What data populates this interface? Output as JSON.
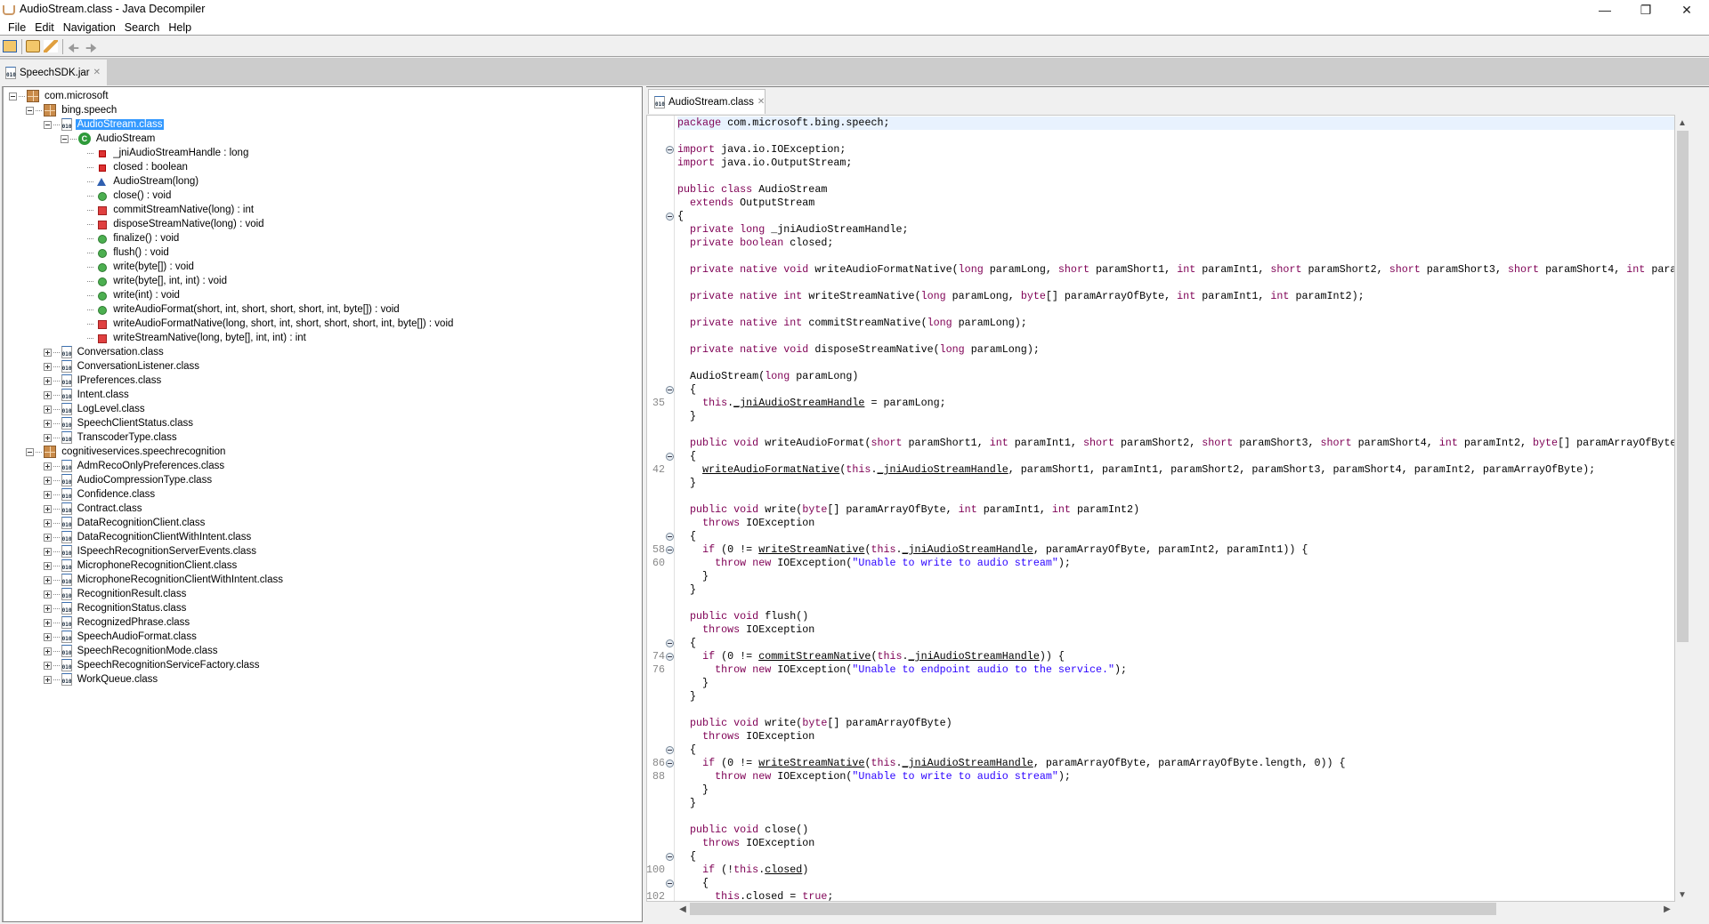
{
  "window": {
    "title": "AudioStream.class - Java Decompiler",
    "controls": [
      "minimize",
      "restore",
      "close"
    ]
  },
  "menu": [
    "File",
    "Edit",
    "Navigation",
    "Search",
    "Help"
  ],
  "toolbar": [
    "open-file-icon",
    "open-type-icon",
    "search-icon",
    "back-icon",
    "forward-icon"
  ],
  "left_tab": {
    "label": "SpeechSDK.jar"
  },
  "editor_tab": {
    "label": "AudioStream.class"
  },
  "tree": [
    {
      "level": 0,
      "icon": "pkg",
      "exp": "minus",
      "label": "com.microsoft"
    },
    {
      "level": 1,
      "icon": "pkg",
      "exp": "minus",
      "label": "bing.speech"
    },
    {
      "level": 2,
      "icon": "cf",
      "exp": "minus",
      "label": "AudioStream.class",
      "selected": true
    },
    {
      "level": 3,
      "icon": "cls",
      "exp": "minus",
      "label": "AudioStream"
    },
    {
      "level": 4,
      "icon": "fpriv",
      "label": "_jniAudioStreamHandle : long"
    },
    {
      "level": 4,
      "icon": "fpriv",
      "label": "closed : boolean"
    },
    {
      "level": 4,
      "icon": "ctor",
      "label": "AudioStream(long)"
    },
    {
      "level": 4,
      "icon": "mpub",
      "label": "close() : void"
    },
    {
      "level": 4,
      "icon": "mpriv",
      "label": "commitStreamNative(long) : int"
    },
    {
      "level": 4,
      "icon": "mpriv",
      "label": "disposeStreamNative(long) : void"
    },
    {
      "level": 4,
      "icon": "mpub",
      "label": "finalize() : void"
    },
    {
      "level": 4,
      "icon": "mpub",
      "label": "flush() : void"
    },
    {
      "level": 4,
      "icon": "mpub",
      "label": "write(byte[]) : void"
    },
    {
      "level": 4,
      "icon": "mpub",
      "label": "write(byte[], int, int) : void"
    },
    {
      "level": 4,
      "icon": "mpub",
      "label": "write(int) : void"
    },
    {
      "level": 4,
      "icon": "mpub",
      "label": "writeAudioFormat(short, int, short, short, short, int, byte[]) : void"
    },
    {
      "level": 4,
      "icon": "mpriv",
      "label": "writeAudioFormatNative(long, short, int, short, short, short, int, byte[]) : void"
    },
    {
      "level": 4,
      "icon": "mpriv",
      "label": "writeStreamNative(long, byte[], int, int) : int"
    },
    {
      "level": 2,
      "icon": "cf",
      "exp": "plus",
      "label": "Conversation.class"
    },
    {
      "level": 2,
      "icon": "cf",
      "exp": "plus",
      "label": "ConversationListener.class"
    },
    {
      "level": 2,
      "icon": "cf",
      "exp": "plus",
      "label": "IPreferences.class"
    },
    {
      "level": 2,
      "icon": "cf",
      "exp": "plus",
      "label": "Intent.class"
    },
    {
      "level": 2,
      "icon": "cf",
      "exp": "plus",
      "label": "LogLevel.class"
    },
    {
      "level": 2,
      "icon": "cf",
      "exp": "plus",
      "label": "SpeechClientStatus.class"
    },
    {
      "level": 2,
      "icon": "cf",
      "exp": "plus",
      "label": "TranscoderType.class"
    },
    {
      "level": 1,
      "icon": "pkg",
      "exp": "minus",
      "label": "cognitiveservices.speechrecognition"
    },
    {
      "level": 2,
      "icon": "cf",
      "exp": "plus",
      "label": "AdmRecoOnlyPreferences.class"
    },
    {
      "level": 2,
      "icon": "cf",
      "exp": "plus",
      "label": "AudioCompressionType.class"
    },
    {
      "level": 2,
      "icon": "cf",
      "exp": "plus",
      "label": "Confidence.class"
    },
    {
      "level": 2,
      "icon": "cf",
      "exp": "plus",
      "label": "Contract.class"
    },
    {
      "level": 2,
      "icon": "cf",
      "exp": "plus",
      "label": "DataRecognitionClient.class"
    },
    {
      "level": 2,
      "icon": "cf",
      "exp": "plus",
      "label": "DataRecognitionClientWithIntent.class"
    },
    {
      "level": 2,
      "icon": "cf",
      "exp": "plus",
      "label": "ISpeechRecognitionServerEvents.class"
    },
    {
      "level": 2,
      "icon": "cf",
      "exp": "plus",
      "label": "MicrophoneRecognitionClient.class"
    },
    {
      "level": 2,
      "icon": "cf",
      "exp": "plus",
      "label": "MicrophoneRecognitionClientWithIntent.class"
    },
    {
      "level": 2,
      "icon": "cf",
      "exp": "plus",
      "label": "RecognitionResult.class"
    },
    {
      "level": 2,
      "icon": "cf",
      "exp": "plus",
      "label": "RecognitionStatus.class"
    },
    {
      "level": 2,
      "icon": "cf",
      "exp": "plus",
      "label": "RecognizedPhrase.class"
    },
    {
      "level": 2,
      "icon": "cf",
      "exp": "plus",
      "label": "SpeechAudioFormat.class"
    },
    {
      "level": 2,
      "icon": "cf",
      "exp": "plus",
      "label": "SpeechRecognitionMode.class"
    },
    {
      "level": 2,
      "icon": "cf",
      "exp": "plus",
      "label": "SpeechRecognitionServiceFactory.class"
    },
    {
      "level": 2,
      "icon": "cf",
      "exp": "plus",
      "label": "WorkQueue.class"
    }
  ],
  "code": [
    {
      "t": "package com.microsoft.bing.speech;",
      "current": true
    },
    {
      "t": ""
    },
    {
      "t": "import java.io.IOException;",
      "fold": true
    },
    {
      "t": "import java.io.OutputStream;"
    },
    {
      "t": ""
    },
    {
      "t": "public class AudioStream"
    },
    {
      "t": "  extends OutputStream"
    },
    {
      "t": "{",
      "fold": true
    },
    {
      "t": "  private long _jniAudioStreamHandle;"
    },
    {
      "t": "  private boolean closed;"
    },
    {
      "t": ""
    },
    {
      "t": "  private native void writeAudioFormatNative(long paramLong, short paramShort1, int paramInt1, short paramShort2, short paramShort3, short paramShort4, int para"
    },
    {
      "t": ""
    },
    {
      "t": "  private native int writeStreamNative(long paramLong, byte[] paramArrayOfByte, int paramInt1, int paramInt2);"
    },
    {
      "t": ""
    },
    {
      "t": "  private native int commitStreamNative(long paramLong);"
    },
    {
      "t": ""
    },
    {
      "t": "  private native void disposeStreamNative(long paramLong);"
    },
    {
      "t": ""
    },
    {
      "t": "  AudioStream(long paramLong)"
    },
    {
      "t": "  {",
      "fold": true
    },
    {
      "t": "    this._jniAudioStreamHandle = paramLong;",
      "ln": "35",
      "links": [
        "_jniAudioStreamHandle"
      ]
    },
    {
      "t": "  }"
    },
    {
      "t": ""
    },
    {
      "t": "  public void writeAudioFormat(short paramShort1, int paramInt1, short paramShort2, short paramShort3, short paramShort4, int paramInt2, byte[] paramArrayOfByte"
    },
    {
      "t": "  {",
      "fold": true
    },
    {
      "t": "    writeAudioFormatNative(this._jniAudioStreamHandle, paramShort1, paramInt1, paramShort2, paramShort3, paramShort4, paramInt2, paramArrayOfByte);",
      "ln": "42",
      "links": [
        "writeAudioFormatNative",
        "_jniAudioStreamHandle"
      ]
    },
    {
      "t": "  }"
    },
    {
      "t": ""
    },
    {
      "t": "  public void write(byte[] paramArrayOfByte, int paramInt1, int paramInt2)"
    },
    {
      "t": "    throws IOException"
    },
    {
      "t": "  {",
      "fold": true
    },
    {
      "t": "    if (0 != writeStreamNative(this._jniAudioStreamHandle, paramArrayOfByte, paramInt2, paramInt1)) {",
      "ln": "58",
      "fold": true,
      "links": [
        "writeStreamNative",
        "_jniAudioStreamHandle"
      ]
    },
    {
      "t": "      throw new IOException(\"Unable to write to audio stream\");",
      "ln": "60"
    },
    {
      "t": "    }"
    },
    {
      "t": "  }"
    },
    {
      "t": ""
    },
    {
      "t": "  public void flush()"
    },
    {
      "t": "    throws IOException"
    },
    {
      "t": "  {",
      "fold": true
    },
    {
      "t": "    if (0 != commitStreamNative(this._jniAudioStreamHandle)) {",
      "ln": "74",
      "fold": true,
      "links": [
        "commitStreamNative",
        "_jniAudioStreamHandle"
      ]
    },
    {
      "t": "      throw new IOException(\"Unable to endpoint audio to the service.\");",
      "ln": "76"
    },
    {
      "t": "    }"
    },
    {
      "t": "  }"
    },
    {
      "t": ""
    },
    {
      "t": "  public void write(byte[] paramArrayOfByte)"
    },
    {
      "t": "    throws IOException"
    },
    {
      "t": "  {",
      "fold": true
    },
    {
      "t": "    if (0 != writeStreamNative(this._jniAudioStreamHandle, paramArrayOfByte, paramArrayOfByte.length, 0)) {",
      "ln": "86",
      "fold": true,
      "links": [
        "writeStreamNative",
        "_jniAudioStreamHandle"
      ]
    },
    {
      "t": "      throw new IOException(\"Unable to write to audio stream\");",
      "ln": "88"
    },
    {
      "t": "    }"
    },
    {
      "t": "  }"
    },
    {
      "t": ""
    },
    {
      "t": "  public void close()"
    },
    {
      "t": "    throws IOException"
    },
    {
      "t": "  {",
      "fold": true
    },
    {
      "t": "    if (!this.closed)",
      "ln": "100",
      "links": [
        "closed"
      ]
    },
    {
      "t": "    {",
      "fold": true
    },
    {
      "t": "      this.closed = true;",
      "ln": "102"
    }
  ],
  "colors": {
    "keyword": "#7f0055",
    "string": "#2a00ff",
    "selection": "#3399ff",
    "current_line": "#e8f2fe"
  }
}
